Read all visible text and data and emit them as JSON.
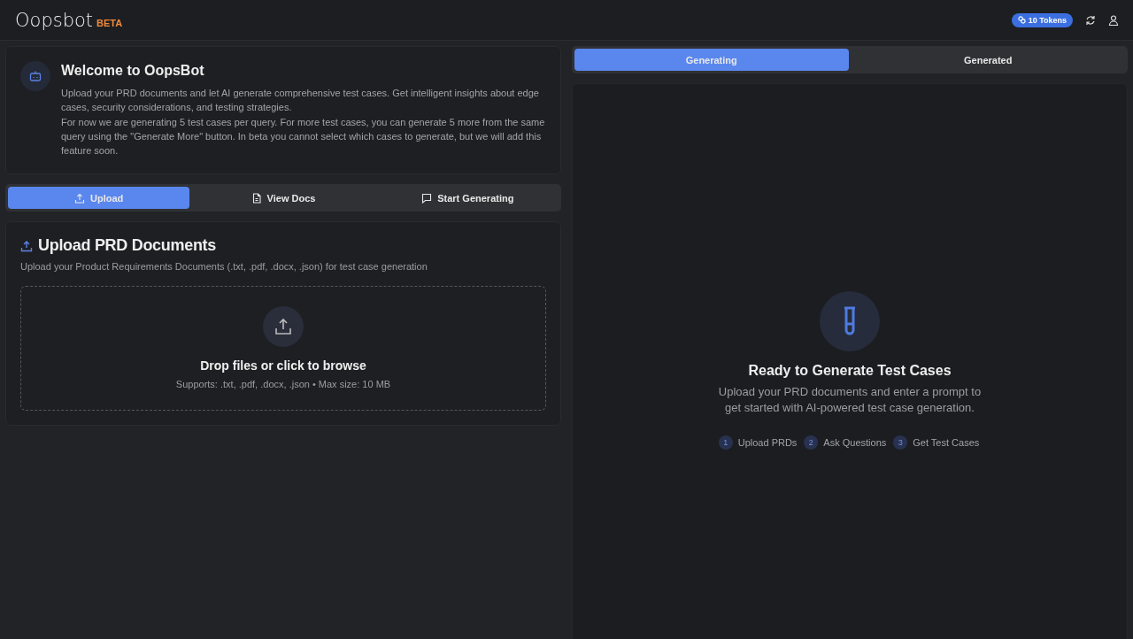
{
  "header": {
    "logo": "Oopsbot",
    "badge": "BETA",
    "tokens": "10 Tokens"
  },
  "welcome": {
    "title": "Welcome to OopsBot",
    "paragraphs": [
      "Upload your PRD documents and let AI generate comprehensive test cases. Get intelligent insights about edge cases, security considerations, and testing strategies.",
      "For now we are generating 5 test cases per query. For more test cases, you can generate 5 more from the same query using the \"Generate More\" button. In beta you cannot select which cases to generate, but we will add this feature soon."
    ]
  },
  "tabs": [
    {
      "label": "Upload",
      "kind": "upload",
      "selected": true
    },
    {
      "label": "View Docs",
      "kind": "docs",
      "selected": false
    },
    {
      "label": "Start Generating",
      "kind": "chat",
      "selected": false
    }
  ],
  "upload": {
    "title": "Upload PRD Documents",
    "subtitle": "Upload your Product Requirements Documents (.txt, .pdf, .docx, .json) for test case generation",
    "drop_title": "Drop files or click to browse",
    "drop_hint": "Supports: .txt, .pdf, .docx, .json • Max size: 10 MB"
  },
  "result_tabs": [
    {
      "label": "Generating",
      "selected": true
    },
    {
      "label": "Generated",
      "selected": false
    }
  ],
  "empty": {
    "title": "Ready to Generate Test Cases",
    "text": "Upload your PRD documents and enter a prompt to get started with AI-powered test case generation.",
    "steps": [
      {
        "number": "1",
        "label": "Upload PRDs"
      },
      {
        "number": "2",
        "label": "Ask Questions"
      },
      {
        "number": "3",
        "label": "Get Test Cases"
      }
    ]
  }
}
